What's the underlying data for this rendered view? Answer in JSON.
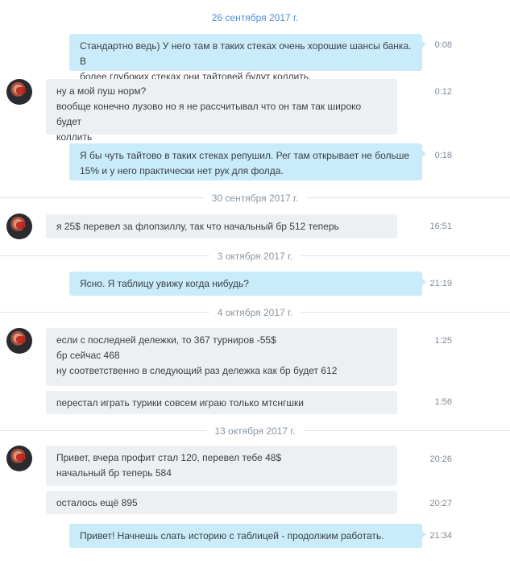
{
  "dates": {
    "d1": "26 сентября 2017 г.",
    "d2": "30 сентября 2017 г.",
    "d3": "3 октября 2017 г.",
    "d4": "4 октября 2017 г.",
    "d5": "13 октября 2017 г."
  },
  "messages": [
    {
      "text": [
        "Стандартно ведь) У него там в таких стеках очень хорошие шансы банка. В",
        "более глубоких стеках они тайтовей будут коллить."
      ],
      "time": "0:08"
    },
    {
      "text": [
        "ну а мой пуш норм?",
        "вообще конечно лузово но я не рассчитывал что он там так широко будет",
        "коллить"
      ],
      "time": "0:12"
    },
    {
      "text": [
        "Я бы чуть тайтово в таких стеках репушил. Рег там открывает не больше",
        "15% и у него практически нет рук для фолда."
      ],
      "time": "0:18"
    },
    {
      "text": [
        "я 25$ перевел за флопзиллу, так что начальный бр 512 теперь"
      ],
      "time": "16:51"
    },
    {
      "text": [
        "Ясно. Я таблицу увижу когда нибудь?"
      ],
      "time": "21:19"
    },
    {
      "text": [
        "если с последней дележки, то 367 турниров -55$",
        "бр сейчас 468",
        "ну соответственно в следующий раз дележка как бр будет 612"
      ],
      "time": "1:25"
    },
    {
      "text": [
        "перестал играть турики совсем играю только мтснгшки"
      ],
      "time": "1:56"
    },
    {
      "text": [
        "Привет, вчера профит стал 120, перевел тебе 48$",
        "начальный бр теперь 584"
      ],
      "time": "20:26"
    },
    {
      "text": [
        "осталось ещё 895"
      ],
      "time": "20:27"
    },
    {
      "text": [
        "Привет! Начнешь слать историю с таблицей - продолжим работать."
      ],
      "time": "21:34"
    }
  ]
}
